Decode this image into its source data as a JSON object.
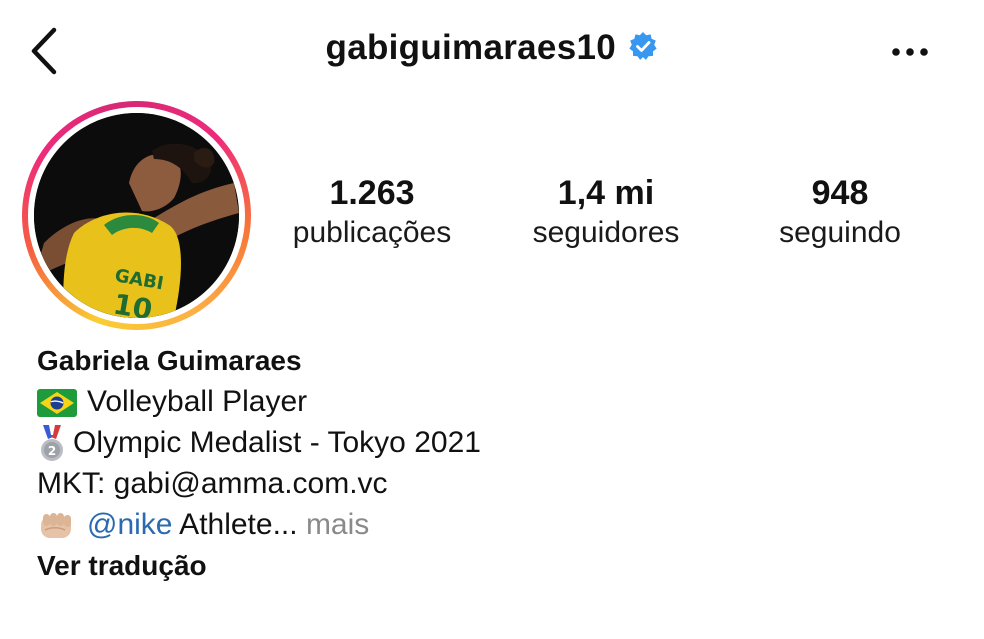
{
  "header": {
    "username": "gabiguimaraes10",
    "verified": true,
    "back_icon": "chevron-left-icon",
    "more_icon": "more-horizontal-icon"
  },
  "stats": {
    "posts": {
      "value": "1.263",
      "label": "publicações"
    },
    "followers": {
      "value": "1,4 mi",
      "label": "seguidores"
    },
    "following": {
      "value": "948",
      "label": "seguindo"
    }
  },
  "bio": {
    "name": "Gabriela Guimaraes",
    "line1": {
      "icon": "brazil-flag-emoji",
      "text": "Volleyball Player"
    },
    "line2": {
      "icon": "silver-medal-emoji",
      "text": "Olympic Medalist - Tokyo 2021"
    },
    "line3": {
      "text": "MKT: gabi@amma.com.vc"
    },
    "line4": {
      "icon": "fist-emoji",
      "mention": "@nike",
      "text": " Athlete...",
      "more": "mais"
    },
    "translate": "Ver tradução"
  },
  "colors": {
    "verified_blue": "#3897f0",
    "link_blue": "#2b6ab1",
    "muted_gray": "#8a8a8a",
    "ring_gradient": [
      "#f9ce34",
      "#ee2a7b",
      "#f77737"
    ]
  }
}
